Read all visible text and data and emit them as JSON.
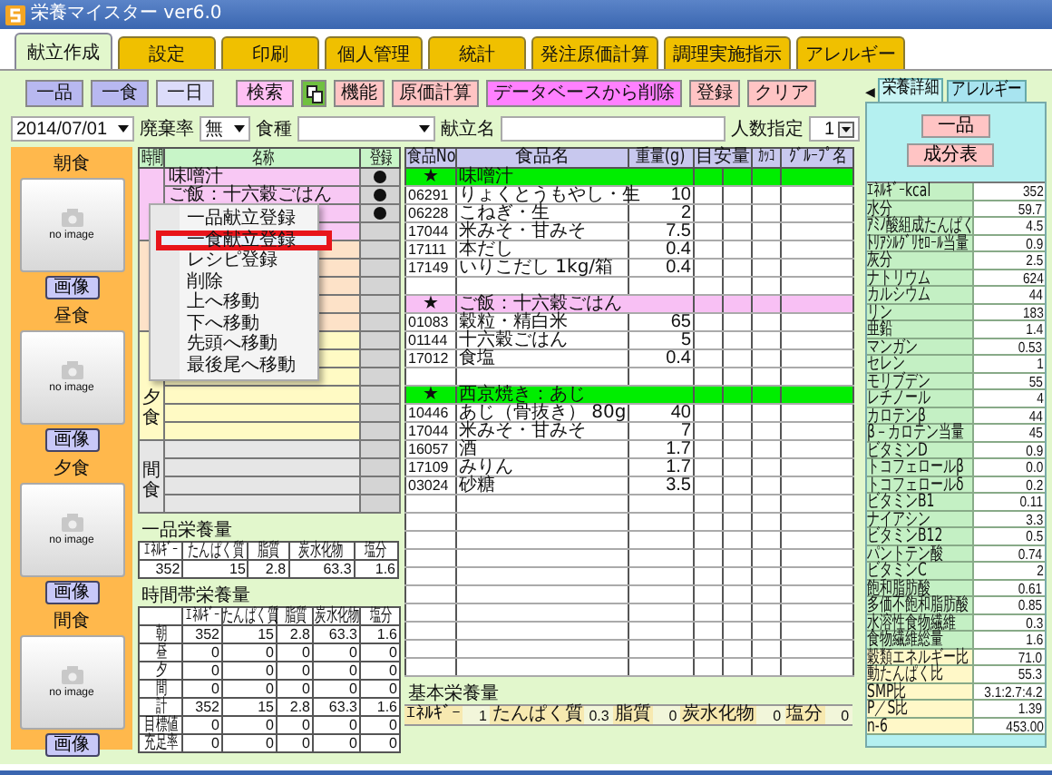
{
  "window": {
    "title": "栄養マイスター ver6.0"
  },
  "tabs": [
    {
      "label": "献立作成",
      "selected": true
    },
    {
      "label": "設定",
      "selected": false
    },
    {
      "label": "印刷",
      "selected": false
    },
    {
      "label": "個人管理",
      "selected": false
    },
    {
      "label": "統計",
      "selected": false
    },
    {
      "label": "発注原価計算",
      "selected": false
    },
    {
      "label": "調理実施指示",
      "selected": false
    },
    {
      "label": "アレルギー",
      "selected": false
    }
  ],
  "toolbar": [
    {
      "kind": "mode",
      "label": "一品",
      "selected": false
    },
    {
      "kind": "mode",
      "label": "一食",
      "selected": false
    },
    {
      "kind": "mode",
      "label": "一日",
      "selected": true
    },
    {
      "kind": "search",
      "label": "検索"
    },
    {
      "kind": "copy"
    },
    {
      "kind": "action",
      "label": "機能"
    },
    {
      "kind": "action",
      "label": "原価計算"
    },
    {
      "kind": "delete",
      "label": "データベースから削除"
    },
    {
      "kind": "action",
      "label": "登録"
    },
    {
      "kind": "action",
      "label": "クリア"
    }
  ],
  "filters": {
    "date": "2014/07/01",
    "waste_label": "廃棄率",
    "waste_value": "無",
    "meal_type_label": "食種",
    "menu_name_label": "献立名",
    "servings_label": "人数指定",
    "servings_value": "1"
  },
  "meals": [
    {
      "label": "朝食",
      "image_text": "no image",
      "button": "画像"
    },
    {
      "label": "昼食",
      "image_text": "no image",
      "button": "画像"
    },
    {
      "label": "夕食",
      "image_text": "no image",
      "button": "画像"
    },
    {
      "label": "間食",
      "image_text": "no image",
      "button": "画像"
    }
  ],
  "meal_table": {
    "columns": [
      "時間",
      "名称",
      "登録"
    ],
    "groups": [
      {
        "color": "#f8c8f4",
        "rows": [
          {
            "name": "味噌汁",
            "registered": true
          },
          {
            "name": "ご飯：十六穀ごはん",
            "registered": true
          },
          {
            "registered": true
          },
          {
            "registered": false
          }
        ]
      },
      {
        "color": "#fde2c8",
        "rows": [
          {
            "registered": false
          },
          {
            "registered": false
          },
          {
            "registered": false
          },
          {
            "registered": false
          },
          {
            "registered": false
          }
        ]
      },
      {
        "label": "夕食",
        "color": "#fffac4",
        "rows": [
          {
            "registered": false
          },
          {
            "registered": false
          },
          {
            "registered": false
          },
          {
            "registered": false
          },
          {
            "registered": false
          },
          {
            "registered": false
          }
        ]
      },
      {
        "label": "間食",
        "color": "#e6e6e6",
        "rows": [
          {
            "registered": false
          },
          {
            "registered": false
          },
          {
            "registered": false
          },
          {
            "registered": false
          }
        ]
      }
    ]
  },
  "context_menu": {
    "items": [
      {
        "label": "一品献立登録",
        "selected": false
      },
      {
        "label": "一食献立登録",
        "selected": true
      },
      {
        "label": "レシピ登録",
        "selected": false
      },
      {
        "label": "削除",
        "selected": false
      },
      {
        "label": "上へ移動",
        "selected": false
      },
      {
        "label": "下へ移動",
        "selected": false
      },
      {
        "label": "先頭へ移動",
        "selected": false
      },
      {
        "label": "最後尾へ移動",
        "selected": false
      }
    ]
  },
  "single_item_nutrition": {
    "title": "一品栄養量",
    "columns": [
      "ｴﾈﾙｷﾞｰ",
      "たんぱく質",
      "脂質",
      "炭水化物",
      "塩分"
    ],
    "values": [
      "352",
      "15",
      "2.8",
      "63.3",
      "1.6"
    ]
  },
  "time_nutrition": {
    "title": "時間帯栄養量",
    "columns": [
      "ｴﾈﾙｷﾞｰ",
      "たんぱく質",
      "脂質",
      "炭水化物",
      "塩分"
    ],
    "rows": [
      {
        "label": "朝",
        "values": [
          "352",
          "15",
          "2.8",
          "63.3",
          "1.6"
        ]
      },
      {
        "label": "昼",
        "values": [
          "0",
          "0",
          "0",
          "0",
          "0"
        ]
      },
      {
        "label": "夕",
        "values": [
          "0",
          "0",
          "0",
          "0",
          "0"
        ]
      },
      {
        "label": "間",
        "values": [
          "0",
          "0",
          "0",
          "0",
          "0"
        ]
      },
      {
        "label": "計",
        "values": [
          "352",
          "15",
          "2.8",
          "63.3",
          "1.6"
        ]
      },
      {
        "label": "目標値",
        "values": [
          "0",
          "0",
          "0",
          "0",
          "0"
        ]
      },
      {
        "label": "充足率",
        "values": [
          "0",
          "0",
          "0",
          "0",
          "0"
        ]
      }
    ]
  },
  "food_table": {
    "columns": [
      "食品No",
      "食品名",
      "重量(g)",
      "目安量",
      "ｶｯｺ",
      "ｸﾞﾙｰﾌﾟ名"
    ],
    "groups": [
      {
        "mark": "★",
        "title": "味噌汁",
        "color": "#00ee00",
        "items": [
          {
            "no": "06291",
            "name": "りょくとうもやし・生",
            "weight": "10"
          },
          {
            "no": "06228",
            "name": "こねぎ・生",
            "weight": "2"
          },
          {
            "no": "17044",
            "name": "米みそ・甘みそ",
            "weight": "7.5"
          },
          {
            "no": "17111",
            "name": "本だし",
            "weight": "0.4"
          },
          {
            "no": "17149",
            "name": "いりこだし 1kg/箱",
            "weight": "0.4"
          }
        ]
      },
      {
        "mark": "★",
        "title": "ご飯：十六穀ごはん",
        "color": "#f8c0f4",
        "items": [
          {
            "no": "01083",
            "name": "穀粒・精白米",
            "weight": "65"
          },
          {
            "no": "01144",
            "name": "十六穀ごはん",
            "weight": "5"
          },
          {
            "no": "17012",
            "name": "食塩",
            "weight": "0.4"
          }
        ]
      },
      {
        "mark": "★",
        "title": "西京焼き：あじ",
        "color": "#00ee00",
        "items": [
          {
            "no": "10446",
            "name": "あじ（骨抜き） 80g",
            "weight": "40"
          },
          {
            "no": "17044",
            "name": "米みそ・甘みそ",
            "weight": "7"
          },
          {
            "no": "16057",
            "name": "酒",
            "weight": "1.7"
          },
          {
            "no": "17109",
            "name": "みりん",
            "weight": "1.7"
          },
          {
            "no": "03024",
            "name": "砂糖",
            "weight": "3.5"
          }
        ]
      }
    ]
  },
  "basic_nutrition": {
    "title": "基本栄養量",
    "items": [
      {
        "label": "ｴﾈﾙｷﾞｰ",
        "value": "1"
      },
      {
        "label": "たんぱく質",
        "value": "0.3"
      },
      {
        "label": "脂質",
        "value": "0"
      },
      {
        "label": "炭水化物",
        "value": "0"
      },
      {
        "label": "塩分",
        "value": "0"
      }
    ]
  },
  "right_panel": {
    "scroll_arrow": "◀",
    "tabs": [
      {
        "label": "栄養詳細",
        "selected": true
      },
      {
        "label": "アレルギー",
        "selected": false
      }
    ],
    "buttons": [
      "一品",
      "成分表"
    ],
    "nutrients": [
      {
        "name": "ｴﾈﾙｷﾞｰkcal",
        "value": "352",
        "kind": "basic"
      },
      {
        "name": "水分",
        "value": "59.7",
        "kind": "basic"
      },
      {
        "name": "ｱﾐﾉ酸組成たんぱく",
        "value": "4.5",
        "kind": "basic"
      },
      {
        "name": "ﾄﾘｱｼﾙｸﾞﾘｾﾛｰﾙ当量",
        "value": "0.9",
        "kind": "basic"
      },
      {
        "name": "灰分",
        "value": "2.5",
        "kind": "basic"
      },
      {
        "name": "ナトリウム",
        "value": "624",
        "kind": "basic"
      },
      {
        "name": "カルシウム",
        "value": "44",
        "kind": "basic"
      },
      {
        "name": "リン",
        "value": "183",
        "kind": "basic"
      },
      {
        "name": "亜鉛",
        "value": "1.4",
        "kind": "basic"
      },
      {
        "name": "マンガン",
        "value": "0.53",
        "kind": "basic"
      },
      {
        "name": "セレン",
        "value": "1",
        "kind": "basic"
      },
      {
        "name": "モリブデン",
        "value": "55",
        "kind": "basic"
      },
      {
        "name": "レチノール",
        "value": "4",
        "kind": "basic"
      },
      {
        "name": "カロテンβ",
        "value": "44",
        "kind": "basic"
      },
      {
        "name": "β－カロテン当量",
        "value": "45",
        "kind": "basic"
      },
      {
        "name": "ビタミンD",
        "value": "0.9",
        "kind": "basic"
      },
      {
        "name": "トコフェロールβ",
        "value": "0.0",
        "kind": "basic"
      },
      {
        "name": "トコフェロールδ",
        "value": "0.2",
        "kind": "basic"
      },
      {
        "name": "ビタミンB1",
        "value": "0.11",
        "kind": "basic"
      },
      {
        "name": "ナイアシン",
        "value": "3.3",
        "kind": "basic"
      },
      {
        "name": "ビタミンB12",
        "value": "0.5",
        "kind": "basic"
      },
      {
        "name": "パントテン酸",
        "value": "0.74",
        "kind": "basic"
      },
      {
        "name": "ビタミンC",
        "value": "2",
        "kind": "basic"
      },
      {
        "name": "飽和脂肪酸",
        "value": "0.61",
        "kind": "basic"
      },
      {
        "name": "多価不飽和脂肪酸",
        "value": "0.85",
        "kind": "basic"
      },
      {
        "name": "水溶性食物繊維",
        "value": "0.3",
        "kind": "basic"
      },
      {
        "name": "食物繊維総量",
        "value": "1.6",
        "kind": "basic"
      },
      {
        "name": "穀類エネルギー比",
        "value": "71.0",
        "kind": "ratio"
      },
      {
        "name": "動たんぱく比",
        "value": "55.3",
        "kind": "ratio"
      },
      {
        "name": "SMP比",
        "value": "3.1:2.7:4.2",
        "kind": "ratio"
      },
      {
        "name": "P／S比",
        "value": "1.39",
        "kind": "ratio"
      },
      {
        "name": "n-6",
        "value": "453.00",
        "kind": "ratio"
      }
    ]
  }
}
